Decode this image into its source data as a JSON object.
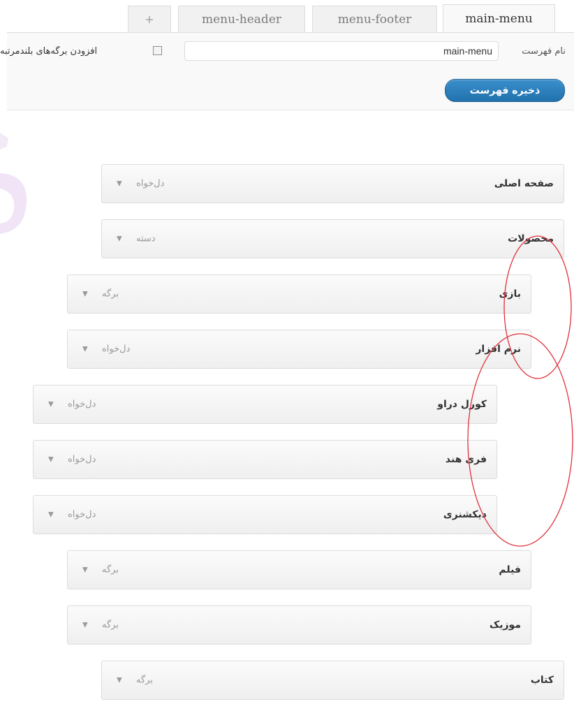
{
  "tabs": [
    {
      "label": "+",
      "active": false
    },
    {
      "label": "menu-header",
      "active": false
    },
    {
      "label": "menu-footer",
      "active": false
    },
    {
      "label": "main-menu",
      "active": true
    }
  ],
  "menu_form": {
    "name_label": "نام فهرست",
    "name_value": "main-menu",
    "auto_add_label": "افزودن برگه‌های بلندمرتبه",
    "auto_add_checked": false,
    "save_label": "ذخیره فهرست"
  },
  "menu_items": [
    {
      "title": "صفحه اصلی",
      "type": "دل‌خواه",
      "depth": 0
    },
    {
      "title": "محصولات",
      "type": "دسته",
      "depth": 0
    },
    {
      "title": "بازی",
      "type": "برگه",
      "depth": 1
    },
    {
      "title": "نرم افزار",
      "type": "دل‌خواه",
      "depth": 1
    },
    {
      "title": "کورل دراو",
      "type": "دل‌خواه",
      "depth": 2
    },
    {
      "title": "فری هند",
      "type": "دل‌خواه",
      "depth": 2
    },
    {
      "title": "دیکشنری",
      "type": "دل‌خواه",
      "depth": 2
    },
    {
      "title": "فیلم",
      "type": "برگه",
      "depth": 1
    },
    {
      "title": "موزیک",
      "type": "برگه",
      "depth": 1
    },
    {
      "title": "کتاب",
      "type": "برگه",
      "depth": 0
    }
  ],
  "icons": {
    "item_toggle": "arrow-down-icon"
  },
  "colors": {
    "accent": "#2172ad",
    "annotation": "#e0303a",
    "item_border": "#dcdcdc"
  }
}
